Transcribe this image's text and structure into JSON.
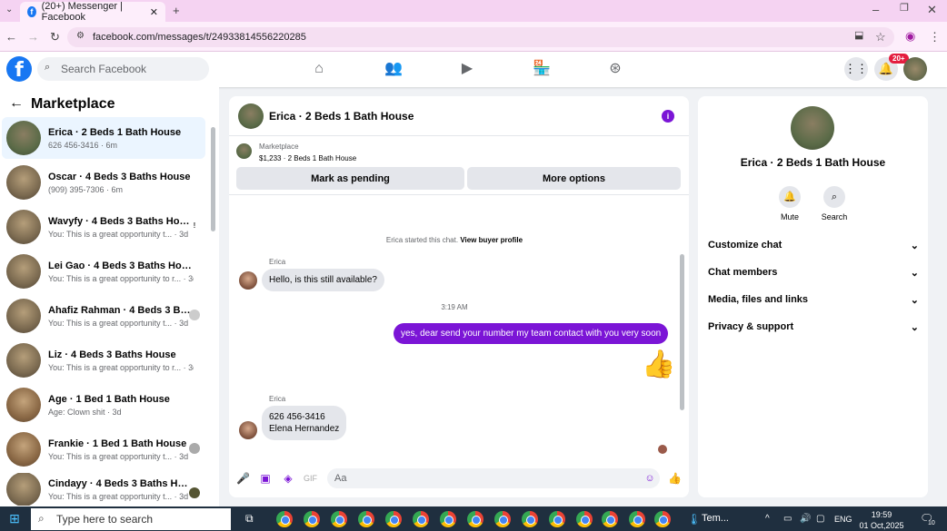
{
  "browser": {
    "tab_title": "(20+) Messenger | Facebook",
    "url": "facebook.com/messages/t/24933814556220285"
  },
  "fb": {
    "search_placeholder": "Search Facebook",
    "notifications_badge": "20+"
  },
  "sidebar": {
    "title": "Marketplace",
    "conversations": [
      {
        "name": "Erica · 2 Beds 1 Bath House",
        "sub": "626 456-3416 · 6m"
      },
      {
        "name": "Oscar · 4 Beds 3 Baths House",
        "sub": "(909) 395-7306 · 6m"
      },
      {
        "name": "Wavyfy · 4 Beds 3 Baths House",
        "sub": "You: This is a great opportunity t... · 3d"
      },
      {
        "name": "Lei Gao · 4 Beds 3 Baths House",
        "sub": "You: This is a great opportunity to r... · 3d"
      },
      {
        "name": "Ahafiz Rahman · 4 Beds 3 Bat...",
        "sub": "You: This is a great opportunity t... · 3d"
      },
      {
        "name": "Liz · 4 Beds 3 Baths House",
        "sub": "You: This is a great opportunity to r... · 3d"
      },
      {
        "name": "Age · 1 Bed 1 Bath House",
        "sub": "Age: Clown shit · 3d"
      },
      {
        "name": "Frankie · 1 Bed 1 Bath House",
        "sub": "You: This is a great opportunity t... · 3d"
      },
      {
        "name": "Cindayy · 4 Beds 3 Baths House",
        "sub": "You: This is a great opportunity t... · 3d"
      }
    ]
  },
  "chat": {
    "title": "Erica · 2 Beds 1 Bath House",
    "marketplace_label": "Marketplace",
    "listing": "$1,233 · 2 Beds 1 Bath House",
    "mark_pending": "Mark as pending",
    "more_options": "More options",
    "system_msg": "Erica started this chat.",
    "view_buyer": "View buyer profile",
    "sender1": "Erica",
    "msg1": "Hello, is this still available?",
    "timestamp": "3:19 AM",
    "msg_out": "yes, dear send your number my team contact with you very soon",
    "sender2": "Erica",
    "msg2_line1": "626 456-3416",
    "msg2_line2": "Elena Hernandez",
    "composer_placeholder": "Aa"
  },
  "rpanel": {
    "name": "Erica · 2 Beds 1 Bath House",
    "mute": "Mute",
    "search": "Search",
    "rows": [
      "Customize chat",
      "Chat members",
      "Media, files and links",
      "Privacy & support"
    ]
  },
  "taskbar": {
    "search_placeholder": "Type here to search",
    "weather": "Tem...",
    "lang": "ENG",
    "time": "19:59",
    "date": "01 Oct,2025",
    "notif_count": "10"
  },
  "colors": {
    "accent": "#7b15d6",
    "fb_blue": "#1877f2"
  }
}
